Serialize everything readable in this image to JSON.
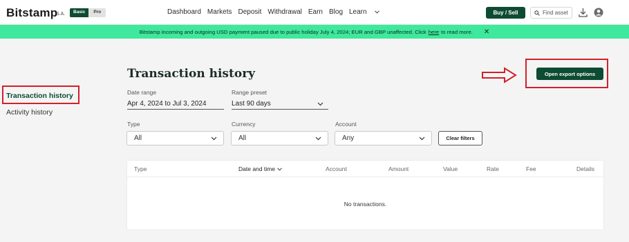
{
  "header": {
    "logo": "Bitstamp",
    "logo_suffix": "S.A.",
    "mode_basic": "Basic",
    "mode_pro": "Pro",
    "nav": [
      "Dashboard",
      "Markets",
      "Deposit",
      "Withdrawal",
      "Earn",
      "Blog",
      "Learn"
    ],
    "buy_sell": "Buy / Sell",
    "search_placeholder": "Find asset"
  },
  "banner": {
    "text_before": "Bitstamp incoming and outgoing USD payment paused due to public holiday July 4, 2024; EUR and GBP unaffected. Click",
    "link": "here",
    "text_after": "to read more.",
    "close": "✕"
  },
  "sidebar": {
    "items": [
      {
        "label": "Transaction history",
        "active": true
      },
      {
        "label": "Activity history",
        "active": false
      }
    ]
  },
  "main": {
    "title": "Transaction history",
    "export_button": "Open export options",
    "filters": {
      "date_range_label": "Date range",
      "date_range_value": "Apr 4, 2024 to Jul 3, 2024",
      "range_preset_label": "Range preset",
      "range_preset_value": "Last 90 days",
      "type_label": "Type",
      "type_value": "All",
      "currency_label": "Currency",
      "currency_value": "All",
      "account_label": "Account",
      "account_value": "Any",
      "clear_filters": "Clear filters"
    },
    "table": {
      "columns": [
        "Type",
        "Date and time",
        "Account",
        "Amount",
        "Value",
        "Rate",
        "Fee",
        "Details"
      ],
      "empty_message": "No transactions."
    }
  },
  "colors": {
    "brand_green": "#0d4b33",
    "banner_green": "#3ee89c",
    "highlight_red": "#d1202a"
  }
}
